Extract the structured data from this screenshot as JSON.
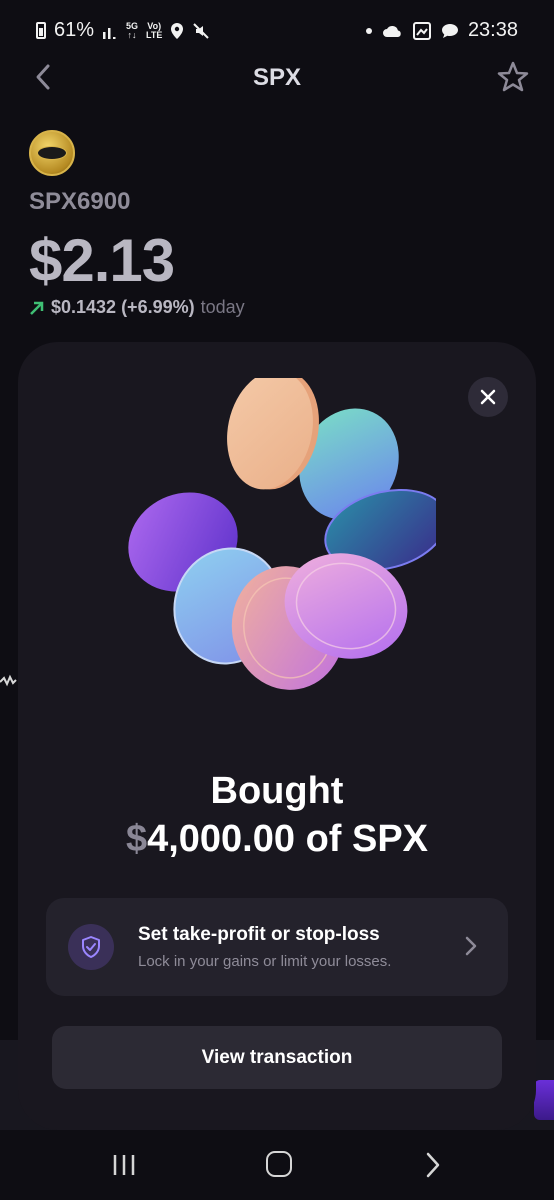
{
  "status_bar": {
    "battery": "61%",
    "net_5g": "5G",
    "volte": "Vo)",
    "lte": "LTE",
    "time": "23:38"
  },
  "header": {
    "title": "SPX"
  },
  "asset": {
    "name": "SPX6900",
    "price": "$2.13",
    "change_value": "$0.1432 (+6.99%)",
    "change_period": "today",
    "change_arrow_color": "#3fbf74"
  },
  "modal": {
    "title": "Bought",
    "amount_currency": "$",
    "amount_rest": "4,000.00 of SPX",
    "option": {
      "title": "Set take-profit or stop-loss",
      "subtitle": "Lock in your gains or limit your losses."
    },
    "view_button": "View transaction"
  },
  "colors": {
    "background": "#0e0d13",
    "modal": "#19171f",
    "accent": "#7b5cff"
  }
}
